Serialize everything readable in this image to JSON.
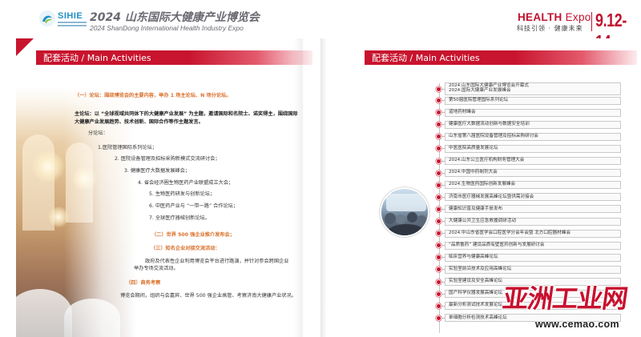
{
  "header": {
    "logo_word": "SIHIE",
    "title_cn": "2024 山东国际大健康产业博览会",
    "title_en": "2024 ShanDong International Health Industry Expo",
    "health": "HEALTH",
    "expo": "Expo",
    "slogan": "科技引领 · 健康未来",
    "dates": "9.12-14"
  },
  "colors": {
    "brand_red": "#c8142e",
    "accent_orange": "#d86f2a",
    "logo_blue": "#1f8fc6"
  },
  "left": {
    "section_title": "配套活动 / Main Activities",
    "forum_heading": "（一）论坛：围绕博览会的主要内容，举办 1 场主论坛、N 场分论坛。",
    "main_forum_line1": "主论坛：以 “全球视域共同体下的大健康产业发展” 为主题，邀请国际和名院士、诺奖得主，围绕国际",
    "main_forum_line2": "大健康产业发展趋势、技术创新、国际合作等作主题发言。",
    "sub_forum_title": "分论坛：",
    "sub_forums": [
      "1.医院管理国际系列论坛；",
      "2. 医院设备管理及招标采购新模式交流研讨会；",
      "3. 健康医疗大数据发展峰会；",
      "4. 省会经济圈生物医药产业联盟成立大会；",
      "5. 生物医药研发与创新论坛；",
      "6. 中医药产业与 “一带一路” 合作论坛；",
      "7. 全球医疗器械创新论坛。"
    ],
    "section2": "（二）世界 500 强企业推介发布会；",
    "section3": "（三）知名企业对接交流活动：",
    "section3_text1": "政府及代表性企业利用博览会平台进行路演，并针对参会跨国企业",
    "section3_text2": "举办专场交流活动。",
    "section4": "（四）商务考察",
    "section4_text": "博览会期间，组织与会嘉宾、世界 500 强企业高管、考察济南大健康产业状况。"
  },
  "right": {
    "section_title": "配套活动 / Main Activities",
    "timeline": [
      {
        "lines": [
          "2024.山东国际大健康产业博览会开幕式",
          "2024.国际大健康产业发展峰会"
        ]
      },
      {
        "lines": [
          "第50届医院管理国际系列论坛"
        ]
      },
      {
        "lines": [
          "道地药材峰会"
        ]
      },
      {
        "lines": [
          "健康医疗大数据流动创新与数据安全培训"
        ]
      },
      {
        "lines": [
          "山东省第八届医院设备管理及招标采购研讨会"
        ]
      },
      {
        "lines": [
          "中医医院高质量发展论坛"
        ]
      },
      {
        "lines": [
          "2024.山东公立医疗机构财务管理大会"
        ]
      },
      {
        "lines": [
          "2024.中国中药制剂大会"
        ]
      },
      {
        "lines": [
          "2024.生物医药国际创新发展峰会"
        ]
      },
      {
        "lines": [
          "济南市医疗器械发展高峰论坛暨供需对接会"
        ]
      },
      {
        "lines": [
          "健康知识普及健康手册发布"
        ]
      },
      {
        "lines": [
          "大健康公共卫生应急救援调研活动"
        ]
      },
      {
        "lines": [
          "2024.中山东省医学会口腔医学分会年会暨 北方口腔器材峰会"
        ]
      },
      {
        "lines": [
          "“品质鲁药” 建设品质有壁医药创新与发展研讨会"
        ]
      },
      {
        "lines": [
          "临床营养与健康高峰论坛"
        ]
      },
      {
        "lines": [
          "实验室前沿技术及应用高峰论坛"
        ]
      },
      {
        "lines": [
          "实验室建设及安全高峰论坛"
        ]
      },
      {
        "lines": [
          "国产科学仪器发展高峰论坛"
        ]
      },
      {
        "lines": [
          "最新分析测试技术发展论坛"
        ]
      },
      {
        "lines": [
          "单细胞分析检测技术高峰论坛"
        ]
      }
    ]
  },
  "watermark": {
    "cn": "亚洲工业网",
    "en": "www.cemao.com"
  }
}
